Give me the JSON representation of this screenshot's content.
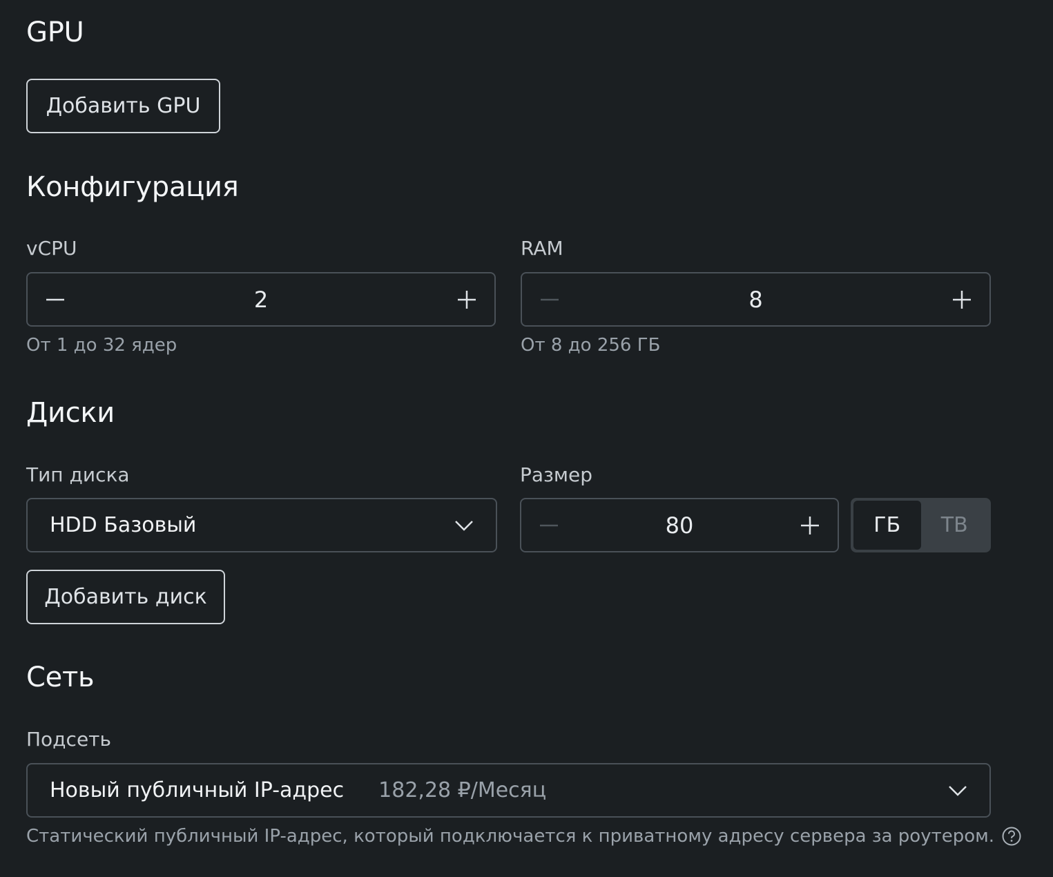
{
  "gpu": {
    "title": "GPU",
    "add_button": "Добавить GPU"
  },
  "config": {
    "title": "Конфигурация",
    "vcpu": {
      "label": "vCPU",
      "value": "2",
      "hint": "От 1 до 32 ядер"
    },
    "ram": {
      "label": "RAM",
      "value": "8",
      "hint": "От 8 до 256 ГБ"
    }
  },
  "disks": {
    "title": "Диски",
    "type_label": "Тип диска",
    "type_value": "HDD Базовый",
    "size_label": "Размер",
    "size_value": "80",
    "units": [
      "ГБ",
      "ТВ"
    ],
    "selected_unit": "ГБ",
    "add_button": "Добавить диск"
  },
  "network": {
    "title": "Сеть",
    "subnet_label": "Подсеть",
    "subnet_value": "Новый публичный IP-адрес",
    "subnet_price": "182,28 ₽/Месяц",
    "hint": "Статический публичный IP-адрес, который подключается к приватному адресу сервера за роутером."
  },
  "icons": {
    "minus": "minus-icon",
    "plus": "plus-icon",
    "chevron": "chevron-down-icon",
    "help": "question-circle-icon"
  },
  "colors": {
    "background": "#1b1f22",
    "border": "#4a5158",
    "text": "#eef0f2",
    "muted": "#9aa2aa"
  }
}
